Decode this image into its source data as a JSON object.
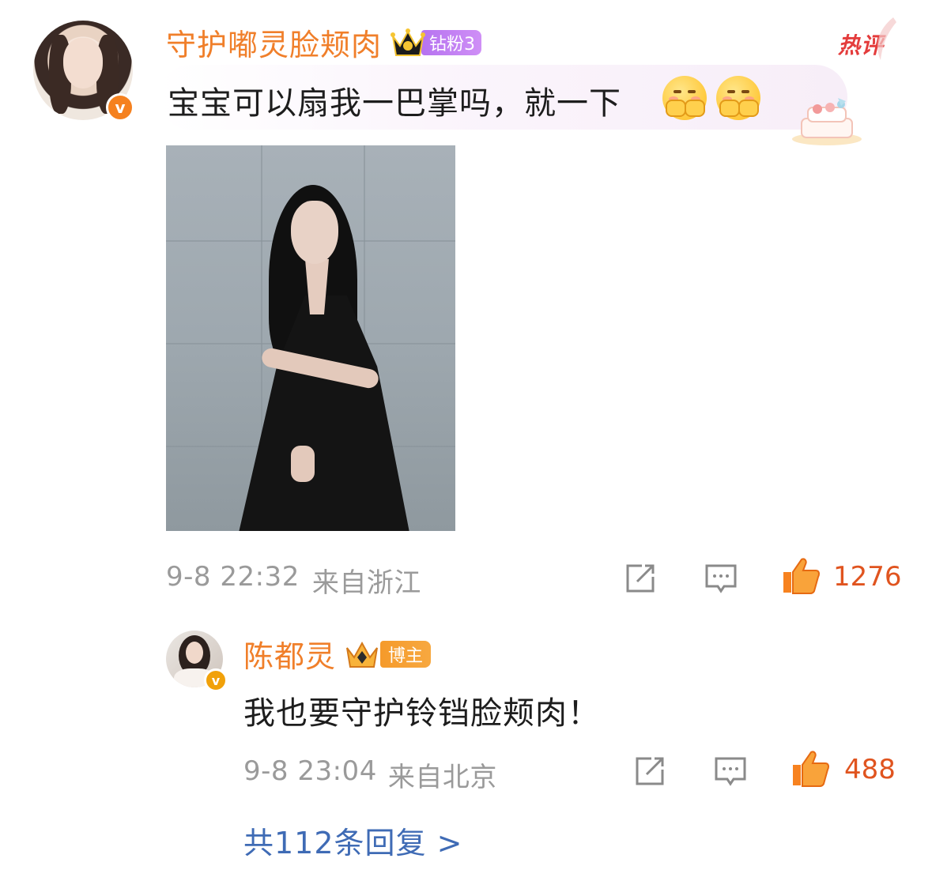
{
  "comment": {
    "username": "守护嘟灵脸颊肉",
    "fan_badge": "钻粉3",
    "hot_tag": "热评",
    "text": "宝宝可以扇我一巴掌吗，就一下",
    "emojis": [
      "shy-blush-emoji",
      "shy-blush-emoji"
    ],
    "timestamp": "9-8 22:32",
    "location": "来自浙江",
    "like_count": "1276"
  },
  "reply": {
    "username": "陈都灵",
    "badge": "博主",
    "text": "我也要守护铃铛脸颊肉！",
    "timestamp": "9-8 23:04",
    "location": "来自北京",
    "like_count": "488"
  },
  "more_replies": "共112条回复 >",
  "colors": {
    "username": "#f07f2a",
    "like_accent": "#e0541f",
    "meta_gray": "#9a9a9a",
    "link_blue": "#3f6bb5",
    "hot_red": "#e43c3c",
    "fan_purple": "#b673f0"
  },
  "icons": [
    "verified-icon",
    "crown-icon",
    "share-icon",
    "comment-icon",
    "thumbs-up-icon",
    "cake-decoration-icon"
  ]
}
